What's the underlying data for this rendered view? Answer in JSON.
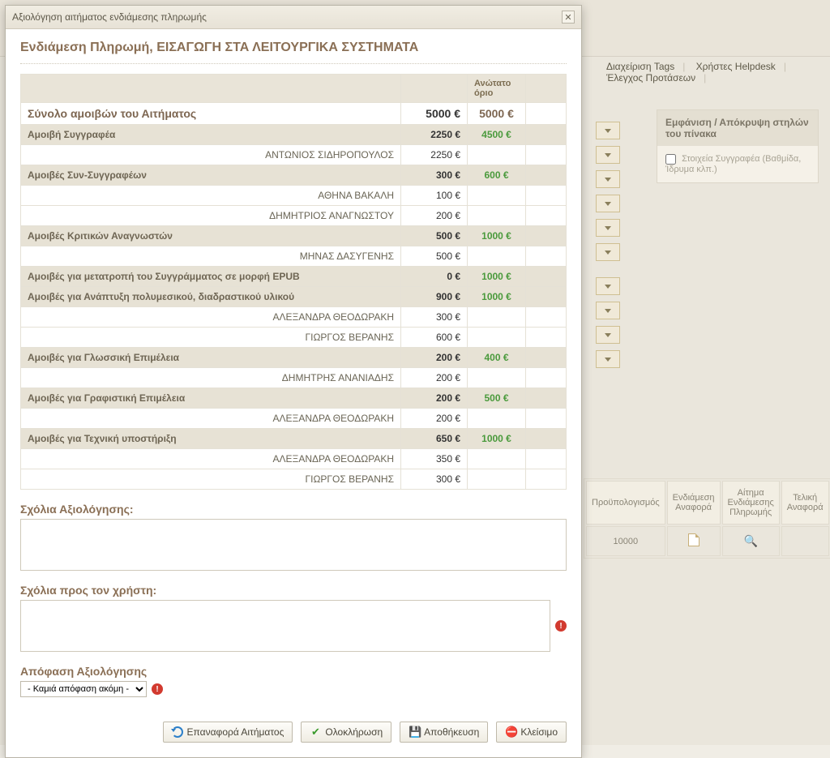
{
  "bg": {
    "menu": [
      "Διαχείριση Tags",
      "Χρήστες Helpdesk",
      "Έλεγχος Προτάσεων"
    ],
    "panel_title": "Εμφάνιση / Απόκρυψη στηλών του πίνακα",
    "panel_checkbox_label": "Στοιχεία Συγγραφέα (Βαθμίδα, Ίδρυμα κλπ.)",
    "table_headers": [
      "Προϋπολογισμός",
      "Ενδιάμεση Αναφορά",
      "Αίτημα Ενδιάμεσης Πληρωμής",
      "Τελική Αναφορά"
    ],
    "table_row": {
      "budget": "10000"
    }
  },
  "modal": {
    "title": "Αξιολόγηση αιτήματος ενδιάμεσης πληρωμής",
    "page_title": "Ενδιάμεση Πληρωμή, ΕΙΣΑΓΩΓΗ ΣΤΑ ΛΕΙΤΟΥΡΓΙΚΑ ΣΥΣΤΗΜΑΤΑ",
    "header_limit": "Ανώτατο όριο",
    "total": {
      "label": "Σύνολο αμοιβών του Αιτήματος",
      "value": "5000 €",
      "limit": "5000 €"
    },
    "rows": [
      {
        "type": "cat",
        "label": "Αμοιβή Συγγραφέα",
        "value": "2250 €",
        "limit": "4500 €"
      },
      {
        "type": "person",
        "label": "ΑΝΤΩΝΙΟΣ ΣΙΔΗΡΟΠΟΥΛΟΣ",
        "value": "2250 €"
      },
      {
        "type": "cat",
        "label": "Αμοιβές Συν-Συγγραφέων",
        "value": "300 €",
        "limit": "600 €"
      },
      {
        "type": "person",
        "label": "ΑΘΗΝΑ ΒΑΚΑΛΗ",
        "value": "100 €"
      },
      {
        "type": "person",
        "label": "ΔΗΜΗΤΡΙΟΣ ΑΝΑΓΝΩΣΤΟΥ",
        "value": "200 €"
      },
      {
        "type": "cat",
        "label": "Αμοιβές Κριτικών Αναγνωστών",
        "value": "500 €",
        "limit": "1000 €"
      },
      {
        "type": "person",
        "label": "ΜΗΝΑΣ ΔΑΣΥΓΕΝΗΣ",
        "value": "500 €"
      },
      {
        "type": "cat",
        "label": "Αμοιβές για μετατροπή του Συγγράμματος σε μορφή EPUB",
        "value": "0 €",
        "limit": "1000 €"
      },
      {
        "type": "cat",
        "label": "Αμοιβές για Ανάπτυξη πολυμεσικού, διαδραστικού υλικού",
        "value": "900 €",
        "limit": "1000 €"
      },
      {
        "type": "person",
        "label": "ΑΛΕΞΑΝΔΡΑ ΘΕΟΔΩΡΑΚΗ",
        "value": "300 €"
      },
      {
        "type": "person",
        "label": "ΓΙΩΡΓΟΣ ΒΕΡΑΝΗΣ",
        "value": "600 €"
      },
      {
        "type": "cat",
        "label": "Αμοιβές για Γλωσσική Επιμέλεια",
        "value": "200 €",
        "limit": "400 €"
      },
      {
        "type": "person",
        "label": "ΔΗΜΗΤΡΗΣ ΑΝΑΝΙΑΔΗΣ",
        "value": "200 €"
      },
      {
        "type": "cat",
        "label": "Αμοιβές για Γραφιστική Επιμέλεια",
        "value": "200 €",
        "limit": "500 €"
      },
      {
        "type": "person",
        "label": "ΑΛΕΞΑΝΔΡΑ ΘΕΟΔΩΡΑΚΗ",
        "value": "200 €"
      },
      {
        "type": "cat",
        "label": "Αμοιβές για Τεχνική υποστήριξη",
        "value": "650 €",
        "limit": "1000 €"
      },
      {
        "type": "person",
        "label": "ΑΛΕΞΑΝΔΡΑ ΘΕΟΔΩΡΑΚΗ",
        "value": "350 €"
      },
      {
        "type": "person",
        "label": "ΓΙΩΡΓΟΣ ΒΕΡΑΝΗΣ",
        "value": "300 €"
      }
    ],
    "eval_comments_label": "Σχόλια Αξιολόγησης:",
    "user_comments_label": "Σχόλια προς τον χρήστη:",
    "decision_label": "Απόφαση Αξιολόγησης",
    "decision_selected": "- Καμιά απόφαση ακόμη -",
    "buttons": {
      "reset": "Επαναφορά Αιτήματος",
      "complete": "Ολοκλήρωση",
      "save": "Αποθήκευση",
      "close": "Κλείσιμο"
    }
  }
}
